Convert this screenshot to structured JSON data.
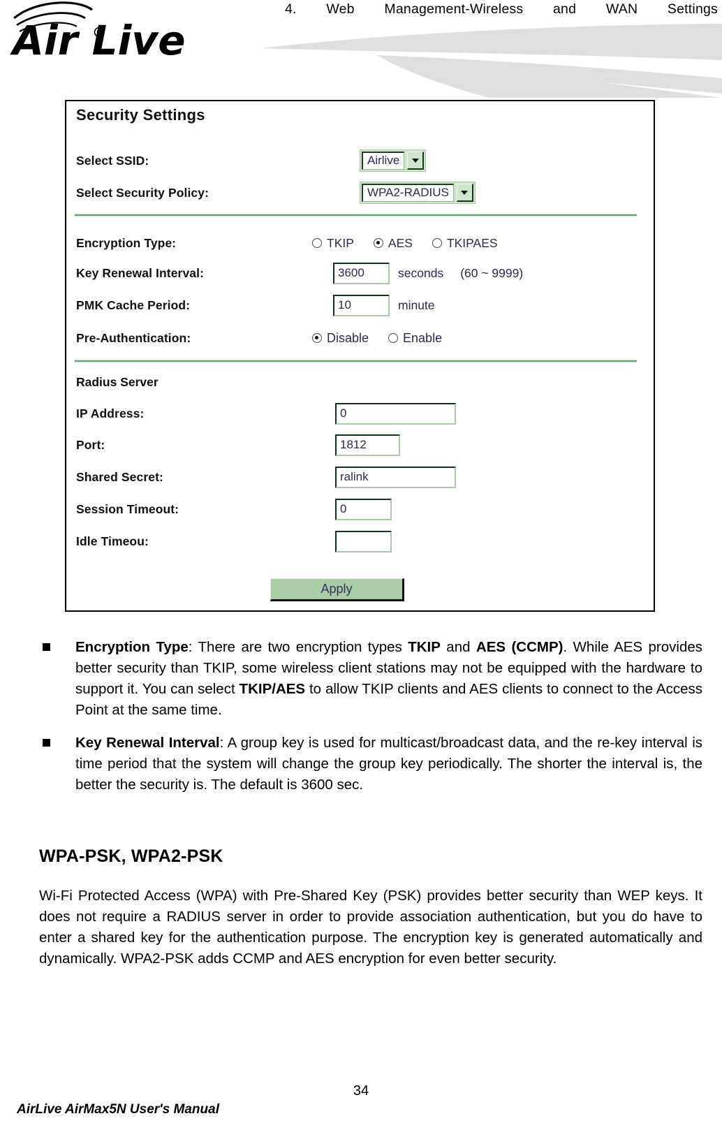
{
  "header": {
    "chapter_title": "4. Web Management-Wireless and WAN Settings",
    "logo_text": "Air Live",
    "logo_mark": "registered-trademark"
  },
  "screenshot_panel": {
    "title": "Security Settings",
    "select_ssid": {
      "label": "Select SSID:",
      "value": "Airlive",
      "icon": "chevron-down-icon"
    },
    "select_security_policy": {
      "label": "Select Security Policy:",
      "value": "WPA2-RADIUS",
      "icon": "chevron-down-icon"
    },
    "encryption_type": {
      "label": "Encryption Type:",
      "options": [
        {
          "label": "TKIP",
          "selected": false
        },
        {
          "label": "AES",
          "selected": true
        },
        {
          "label": "TKIPAES",
          "selected": false
        }
      ]
    },
    "key_renewal_interval": {
      "label": "Key Renewal Interval:",
      "value": "3600",
      "unit": "seconds",
      "range": "(60 ~ 9999)"
    },
    "pmk_cache_period": {
      "label": "PMK Cache Period:",
      "value": "10",
      "unit": "minute"
    },
    "pre_authentication": {
      "label": "Pre-Authentication:",
      "options": [
        {
          "label": "Disable",
          "selected": true
        },
        {
          "label": "Enable",
          "selected": false
        }
      ]
    },
    "radius_server": {
      "heading": "Radius Server",
      "fields": [
        {
          "label": "IP Address:",
          "value": "0",
          "size": "lg"
        },
        {
          "label": "Port:",
          "value": "1812",
          "size": "md"
        },
        {
          "label": "Shared Secret:",
          "value": "ralink",
          "size": "lg"
        },
        {
          "label": "Session Timeout:",
          "value": "0",
          "size": "sm"
        },
        {
          "label": "Idle Timeou:",
          "value": "",
          "size": "sm"
        }
      ]
    },
    "apply_button": "Apply",
    "colors": {
      "widget_green": "#cfe3cd",
      "divider_green": "#63a472",
      "button_green": "#a9cca7",
      "field_text": "#2b2b4e"
    }
  },
  "bullets": [
    {
      "term": "Encryption Type",
      "text_html": "<b>Encryption Type</b>: There are two encryption types <b>TKIP</b> and <b>AES (CCMP)</b>. While AES provides better security than TKIP, some wireless client stations may not be equipped with the hardware to support it. You can select <b>TKIP/AES</b> to allow TKIP clients and AES clients to connect to the Access Point at the same time."
    },
    {
      "term": "Key Renewal Interval",
      "text_html": "<b>Key Renewal Interval</b>: A group key is used for multicast/broadcast data, and the re-key interval is time period that the system will change the group key periodically. The shorter the interval is, the better the security is. The default is 3600 sec."
    }
  ],
  "section": {
    "heading": "WPA-PSK, WPA2-PSK",
    "paragraph": "Wi-Fi Protected Access (WPA) with Pre-Shared Key (PSK) provides better security than WEP keys. It does not require a RADIUS server in order to provide association authentication, but you do have to enter a shared key for the authentication purpose. The encryption key is generated automatically and dynamically. WPA2-PSK adds CCMP and AES encryption for even better security."
  },
  "footer": {
    "manual_title": "AirLive AirMax5N User's Manual",
    "page_number": "34"
  }
}
